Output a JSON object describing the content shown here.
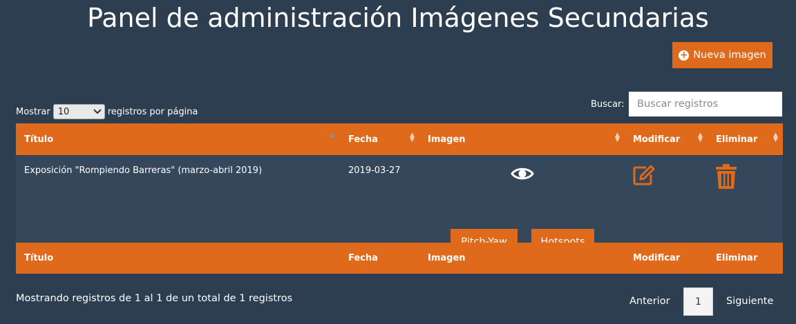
{
  "header": {
    "title": "Panel de administración Imágenes Secundarias",
    "new_button_label": "Nueva imagen"
  },
  "controls": {
    "show_label": "Mostrar",
    "page_length": "10",
    "per_page_label": "registros por página",
    "search_label": "Buscar:",
    "search_placeholder": "Buscar registros"
  },
  "table": {
    "columns": [
      "Título",
      "Fecha",
      "Imagen",
      "Modificar",
      "Eliminar"
    ],
    "rows": [
      {
        "titulo": "Exposición \"Rompiendo Barreras\" (marzo-abril 2019)",
        "fecha": "2019-03-27",
        "pitch_yaw_label": "Pitch-Yaw",
        "hotspots_label": "Hotspots"
      }
    ]
  },
  "footer": {
    "info": "Mostrando registros de 1 al 1 de un total de 1 registros",
    "prev_label": "Anterior",
    "current_page": "1",
    "next_label": "Siguiente"
  },
  "colors": {
    "background": "#2c3e50",
    "accent": "#e06a1b",
    "row_bg": "#35475b"
  },
  "icons": [
    "plus-circle-icon",
    "chevron-down-icon",
    "sort-icon",
    "eye-icon",
    "edit-icon",
    "trash-icon"
  ]
}
